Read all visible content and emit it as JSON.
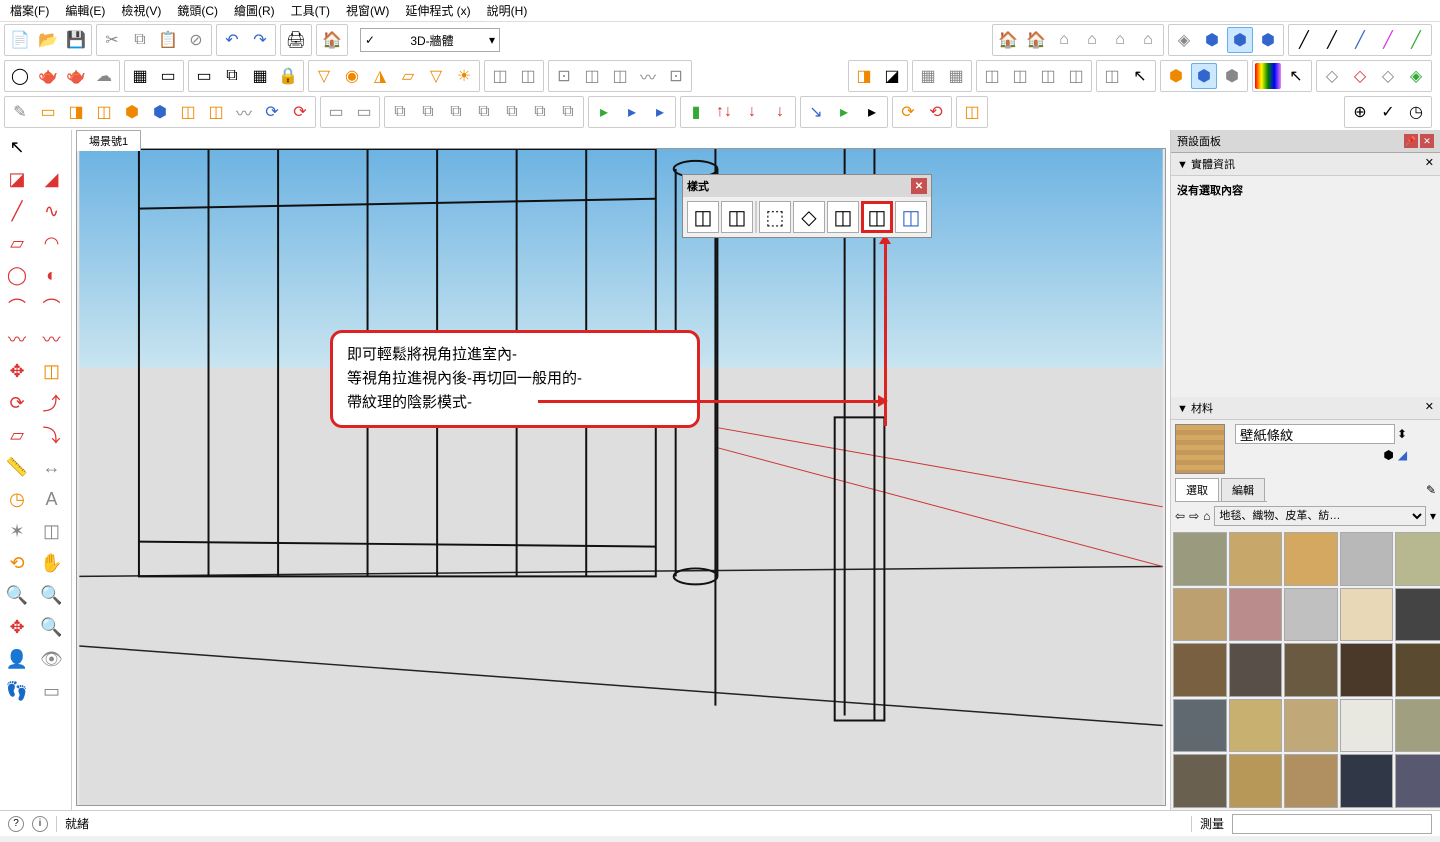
{
  "menu": {
    "file": "檔案(F)",
    "edit": "編輯(E)",
    "view": "檢視(V)",
    "camera": "鏡頭(C)",
    "draw": "繪圖(R)",
    "tools": "工具(T)",
    "window": "視窗(W)",
    "ext": "延伸程式 (x)",
    "help": "說明(H)"
  },
  "toolbar": {
    "layer_dropdown": "3D-牆體",
    "check": "✓"
  },
  "scene_tab": "場景號1",
  "styles_popup": {
    "title": "樣式"
  },
  "callout": {
    "line1": "即可輕鬆將視角拉進室內-",
    "line2": "等視角拉進視內後-再切回一般用的-",
    "line3": "帶紋理的陰影模式-"
  },
  "right_panel": {
    "presets_title": "預設面板",
    "entity_info": "實體資訊",
    "no_selection": "沒有選取內容",
    "materials": "材料",
    "material_name": "壁紙條紋",
    "select_tab": "選取",
    "edit_tab": "編輯",
    "category": "地毯、織物、皮革、紡…"
  },
  "statusbar": {
    "ready": "就緒",
    "measure": "測量"
  },
  "material_colors": [
    "#9a9a7f",
    "#c8a86a",
    "#d4a860",
    "#b8b8b8",
    "#b8b890",
    "#bda070",
    "#ba8c8c",
    "#c0c0c0",
    "#e8d8b8",
    "#444444",
    "#786040",
    "#585048",
    "#6a5a42",
    "#4a3828",
    "#5a4a30",
    "#606870",
    "#c8b070",
    "#c0a878",
    "#e8e8e0",
    "#a0a080",
    "#6a6050",
    "#b89858",
    "#b09060",
    "#303848",
    "#585870"
  ]
}
